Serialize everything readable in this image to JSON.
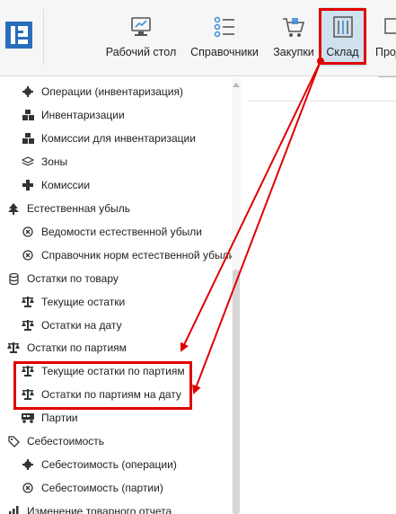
{
  "toolbar": {
    "buttons": [
      {
        "label": "Рабочий стол",
        "icon": "desktop-icon"
      },
      {
        "label": "Справочники",
        "icon": "list-icon"
      },
      {
        "label": "Закупки",
        "icon": "cart-icon"
      },
      {
        "label": "Склад",
        "icon": "warehouse-icon",
        "active": true
      },
      {
        "label": "Прод",
        "icon": "sales-icon"
      }
    ]
  },
  "tree": {
    "items": [
      {
        "label": "Операции (инвентаризация)",
        "icon": "gear-icon"
      },
      {
        "label": "Инвентаризации",
        "icon": "boxes-icon"
      },
      {
        "label": "Комиссии для инвентаризации",
        "icon": "boxes-icon"
      },
      {
        "label": "Зоны",
        "icon": "layers-icon"
      },
      {
        "label": "Комиссии",
        "icon": "cross-icon"
      },
      {
        "label": "Естественная убыль",
        "icon": "tree-icon"
      },
      {
        "label": "Ведомости естественной убыли",
        "icon": "circle-x-icon"
      },
      {
        "label": "Справочник норм естественной убыли",
        "icon": "circle-x-icon"
      },
      {
        "label": "Остатки по товару",
        "icon": "database-icon"
      },
      {
        "label": "Текущие остатки",
        "icon": "scales-icon"
      },
      {
        "label": "Остатки на дату",
        "icon": "scales-icon"
      },
      {
        "label": "Остатки по партиям",
        "icon": "scales-icon"
      },
      {
        "label": "Текущие остатки по партиям",
        "icon": "scales-icon"
      },
      {
        "label": "Остатки по партиям на дату",
        "icon": "scales-icon"
      },
      {
        "label": "Партии",
        "icon": "truck-icon"
      },
      {
        "label": "Себестоимость",
        "icon": "tag-icon"
      },
      {
        "label": "Себестоимость (операции)",
        "icon": "gear-icon"
      },
      {
        "label": "Себестоимость (партии)",
        "icon": "circle-x-icon"
      },
      {
        "label": "Изменение товарного отчета",
        "icon": "chart-icon"
      }
    ]
  },
  "colors": {
    "accent_red": "#e00000",
    "active_bg": "#cfe1ee",
    "logo_blue": "#2a6ebb"
  }
}
